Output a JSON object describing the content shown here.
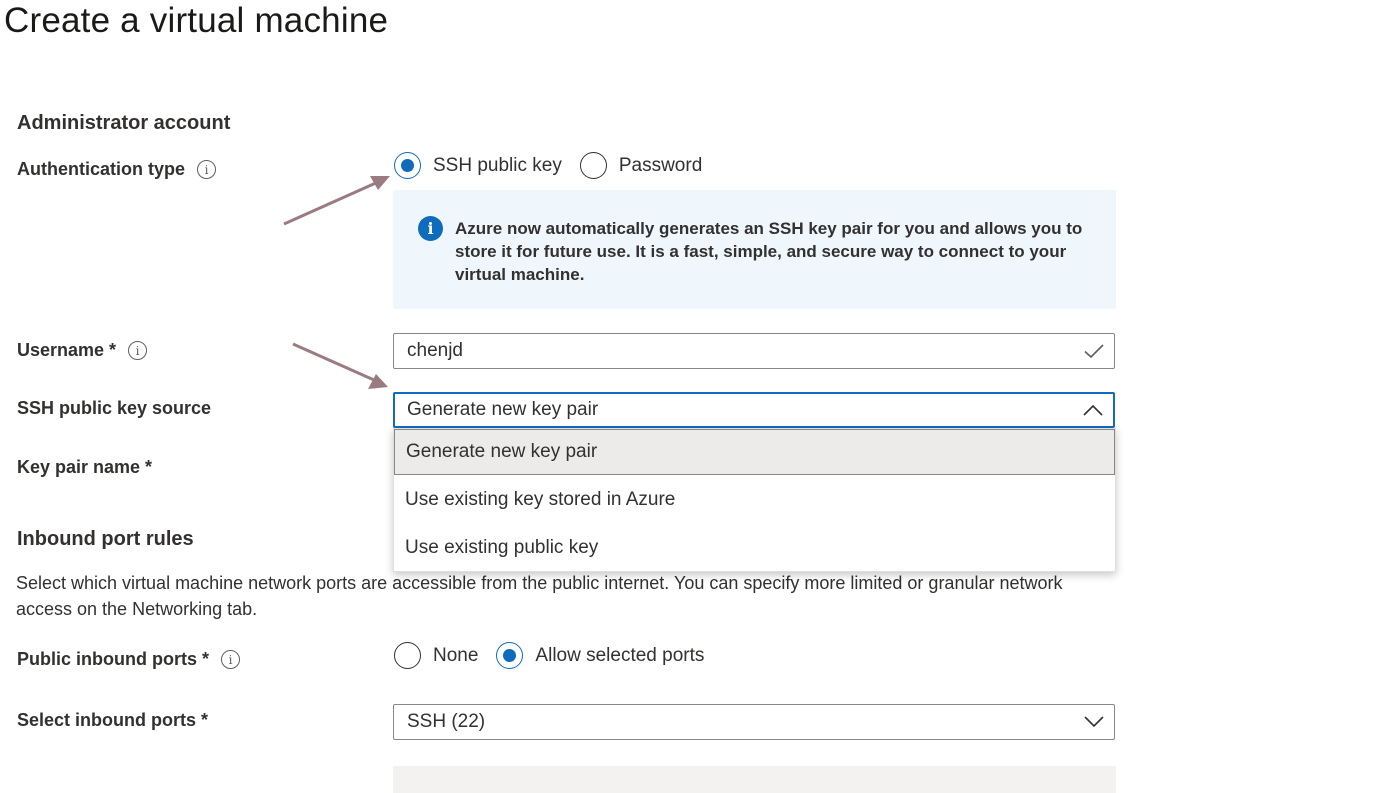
{
  "page": {
    "title": "Create a virtual machine"
  },
  "admin": {
    "heading": "Administrator account",
    "auth_type": {
      "label": "Authentication type",
      "info_glyph": "i",
      "options": [
        {
          "label": "SSH public key",
          "checked": true
        },
        {
          "label": "Password",
          "checked": false
        }
      ]
    },
    "info_box": {
      "icon_glyph": "i",
      "text": "Azure now automatically generates an SSH key pair for you and allows you to store it for future use. It is a fast, simple, and secure way to connect to your virtual machine."
    },
    "username": {
      "label": "Username *",
      "info_glyph": "i",
      "value": "chenjd",
      "valid_icon": "checkmark-icon"
    },
    "ssh_key_source": {
      "label": "SSH public key source",
      "value": "Generate new key pair",
      "expanded": true,
      "options": [
        "Generate new key pair",
        "Use existing key stored in Azure",
        "Use existing public key"
      ]
    },
    "key_pair_name": {
      "label": "Key pair name *"
    }
  },
  "inbound": {
    "heading": "Inbound port rules",
    "description": "Select which virtual machine network ports are accessible from the public internet. You can specify more limited or granular network access on the Networking tab.",
    "public_ports": {
      "label": "Public inbound ports *",
      "info_glyph": "i",
      "options": [
        {
          "label": "None",
          "checked": false
        },
        {
          "label": "Allow selected ports",
          "checked": true
        }
      ]
    },
    "select_ports": {
      "label": "Select inbound ports *",
      "value": "SSH (22)"
    }
  },
  "colors": {
    "accent": "#0f6cbd",
    "info_bg": "#eff6fc",
    "annotation_arrow": "#9b7b82"
  }
}
